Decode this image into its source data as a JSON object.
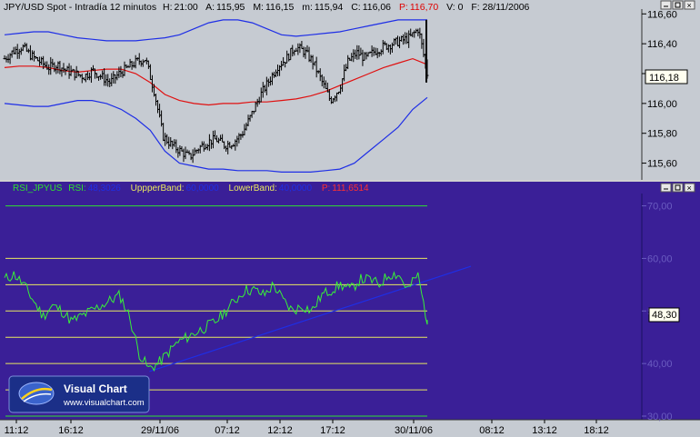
{
  "header": {
    "symbol": "JPY/USD Spot - Intradía 12 minutos",
    "h_label": "H:",
    "h_value": "21:00",
    "a_label": "A:",
    "a_value": "115,95",
    "m_label": "M:",
    "m_value": "116,15",
    "mm_label": "m:",
    "mm_value": "115,94",
    "c_label": "C:",
    "c_value": "116,06",
    "p_label": "P:",
    "p_value": "116,70",
    "v_label": "V: 0",
    "f_label": "F: 28/11/2006"
  },
  "indicator": {
    "name": "RSI_JPYUS",
    "rsi_label": "RSI:",
    "rsi_value": "48,3026",
    "upper_label": "UppperBand:",
    "upper_value": "60,0000",
    "lower_label": "LowerBand:",
    "lower_value": "40,0000",
    "p_label": "P:",
    "p_value": "111,6514"
  },
  "price_tag": "116,18",
  "rsi_tag": "48,30",
  "logo": {
    "name": "Visual Chart",
    "url": "www.visualchart.com"
  },
  "colors": {
    "top_bg": "#c6cbd2",
    "bottom_bg": "#3a1f97",
    "bands": "#1e2ee6",
    "ma": "#e01010",
    "rsi": "#38f038",
    "hline_green": "#30e030",
    "hline_yellow": "#e8e860",
    "trend": "#1e2ee6"
  },
  "chart_data": [
    {
      "type": "line",
      "title": "JPY/USD Spot - Intradía 12 minutos",
      "ylim": [
        115.5,
        116.62
      ],
      "y_ticks": [
        "116,60",
        "116,40",
        "116,20",
        "116,00",
        "115,80",
        "115,60"
      ],
      "x_ticks": [
        "11:12",
        "16:12",
        "29/11/06",
        "07:12",
        "12:12",
        "17:12",
        "30/11/06",
        "08:12",
        "13:12",
        "18:12"
      ],
      "series": [
        {
          "type": "ohlc",
          "x": [
            0,
            3,
            6,
            9,
            12,
            15,
            18,
            21,
            24,
            27,
            30,
            33,
            36,
            39,
            42,
            45,
            48,
            51,
            54,
            57,
            60,
            63,
            66,
            69,
            72,
            75,
            78,
            81,
            84,
            87,
            90,
            93,
            96,
            99,
            102,
            105,
            108,
            111,
            114,
            117,
            120,
            123,
            126,
            129,
            132,
            135,
            138,
            141,
            144
          ],
          "values": [
            116.3,
            116.35,
            116.38,
            116.32,
            116.28,
            116.24,
            116.26,
            116.22,
            116.2,
            116.18,
            116.22,
            116.18,
            116.14,
            116.2,
            116.24,
            116.28,
            116.3,
            116.08,
            115.78,
            115.72,
            115.68,
            115.64,
            115.7,
            115.74,
            115.76,
            115.72,
            115.74,
            115.8,
            115.92,
            116.05,
            116.15,
            116.25,
            116.3,
            116.38,
            116.35,
            116.28,
            116.15,
            116.02,
            116.1,
            116.28,
            116.34,
            116.3,
            116.35,
            116.38,
            116.4,
            116.42,
            116.44,
            116.5,
            116.2
          ]
        },
        {
          "name": "",
          "type": "band-upper",
          "values": [
            116.46,
            116.47,
            116.48,
            116.48,
            116.46,
            116.44,
            116.43,
            116.42,
            116.42,
            116.42,
            116.43,
            116.44,
            116.46,
            116.5,
            116.54,
            116.56,
            116.56,
            116.54,
            116.5,
            116.46,
            116.45,
            116.46,
            116.47,
            116.48,
            116.5,
            116.52,
            116.54,
            116.56,
            116.56,
            116.56
          ]
        },
        {
          "name": "",
          "type": "band-lower",
          "values": [
            116.0,
            115.99,
            115.98,
            115.98,
            116.0,
            116.02,
            116.02,
            116.0,
            115.96,
            115.9,
            115.82,
            115.68,
            115.6,
            115.58,
            115.56,
            115.56,
            115.55,
            115.55,
            115.55,
            115.54,
            115.54,
            115.54,
            115.55,
            115.56,
            115.6,
            115.68,
            115.76,
            115.84,
            115.96,
            116.04
          ]
        },
        {
          "name": "",
          "type": "moving-average",
          "values": [
            116.24,
            116.25,
            116.25,
            116.24,
            116.22,
            116.21,
            116.22,
            116.23,
            116.23,
            116.2,
            116.14,
            116.06,
            116.02,
            116.0,
            115.99,
            116.0,
            116.0,
            116.01,
            116.01,
            116.02,
            116.03,
            116.05,
            116.08,
            116.12,
            116.16,
            116.2,
            116.24,
            116.27,
            116.3,
            116.26
          ]
        }
      ]
    },
    {
      "type": "line",
      "title": "RSI_JPYUS",
      "ylim": [
        30,
        72
      ],
      "y_ticks": [
        "70,00",
        "60,00",
        "50,00",
        "40,00",
        "30,00"
      ],
      "hlines": [
        70,
        60,
        55,
        50,
        45,
        40,
        35,
        30
      ],
      "series": [
        {
          "name": "RSI",
          "values": [
            56,
            57,
            55,
            52,
            49,
            51,
            50,
            48,
            49,
            50,
            51,
            52,
            53,
            49,
            42,
            39,
            40,
            42,
            44,
            45,
            46,
            47,
            48,
            50,
            52,
            54,
            54,
            53,
            55,
            52,
            50,
            51,
            50,
            53,
            54,
            55,
            54,
            56,
            56,
            55,
            57,
            57,
            54,
            57,
            48
          ]
        },
        {
          "name": "",
          "type": "trendline",
          "x": [
            0.235,
            0.74
          ],
          "values": [
            38.5,
            58.5
          ]
        }
      ]
    }
  ]
}
